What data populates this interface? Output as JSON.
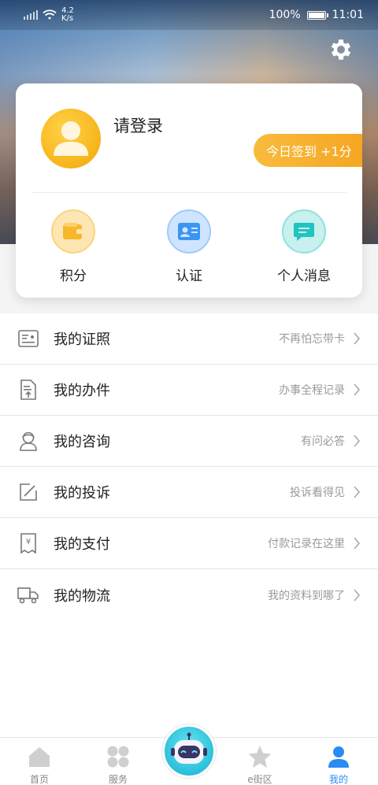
{
  "status_bar": {
    "speed_top": "4.2",
    "speed_bottom": "K/s",
    "battery": "100%",
    "time": "11:01"
  },
  "profile": {
    "login_prompt": "请登录",
    "checkin_label": "今日签到 +1分"
  },
  "quick_actions": [
    {
      "label": "积分",
      "icon": "wallet-icon",
      "color": "#f9b82a"
    },
    {
      "label": "认证",
      "icon": "id-card-icon",
      "color": "#3a95f3"
    },
    {
      "label": "个人消息",
      "icon": "message-icon",
      "color": "#20c4c0"
    }
  ],
  "menu": [
    {
      "label": "我的证照",
      "hint": "不再怕忘带卡",
      "icon": "license-icon"
    },
    {
      "label": "我的办件",
      "hint": "办事全程记录",
      "icon": "document-icon"
    },
    {
      "label": "我的咨询",
      "hint": "有问必答",
      "icon": "consult-icon"
    },
    {
      "label": "我的投诉",
      "hint": "投诉看得见",
      "icon": "edit-icon"
    },
    {
      "label": "我的支付",
      "hint": "付款记录在这里",
      "icon": "payment-icon"
    },
    {
      "label": "我的物流",
      "hint": "我的资料到哪了",
      "icon": "truck-icon"
    }
  ],
  "bottom_nav": [
    {
      "label": "首页",
      "icon": "home-icon"
    },
    {
      "label": "服务",
      "icon": "services-icon"
    },
    {
      "label": "",
      "icon": "robot-icon"
    },
    {
      "label": "e街区",
      "icon": "star-icon"
    },
    {
      "label": "我的",
      "icon": "user-icon",
      "active": true
    }
  ],
  "colors": {
    "accent": "#2a8bf2",
    "checkin": "#f6a623",
    "avatar": "#f7b41a"
  }
}
